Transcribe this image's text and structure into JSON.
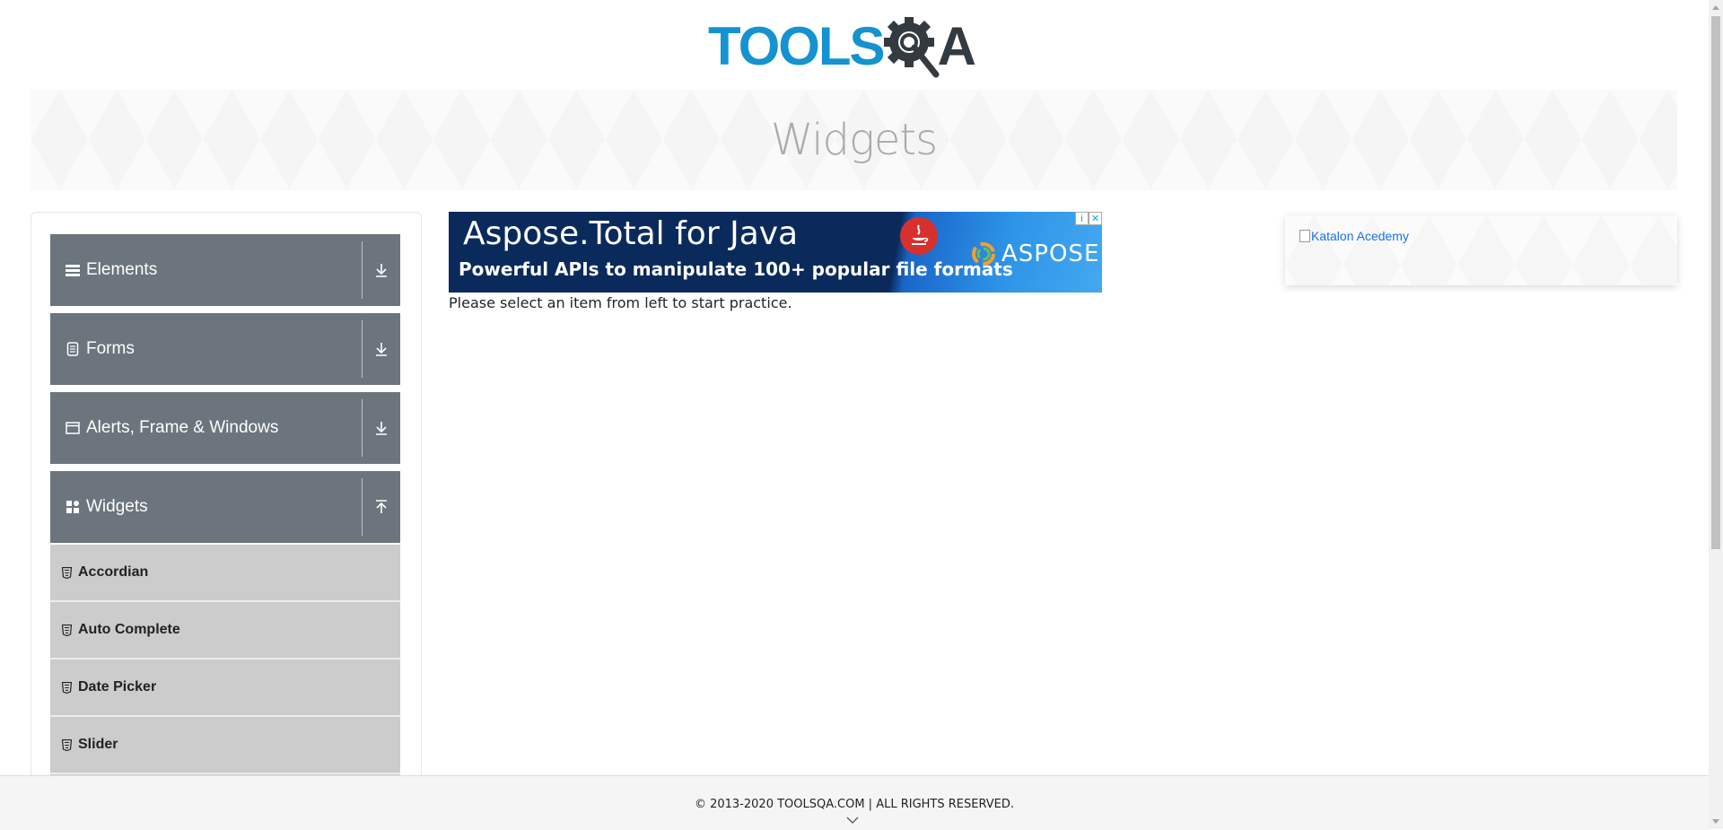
{
  "logo": {
    "part1": "TOOLS",
    "part2": "A",
    "icon": "gear-magnifier-icon",
    "colors": {
      "tools": "#1592d0",
      "dark": "#333a40"
    }
  },
  "banner": {
    "title": "Widgets"
  },
  "sidebar": {
    "groups": [
      {
        "label": "Elements",
        "icon": "hamburger-icon",
        "state": "collapsed"
      },
      {
        "label": "Forms",
        "icon": "document-icon",
        "state": "collapsed"
      },
      {
        "label": "Alerts, Frame & Windows",
        "icon": "window-icon",
        "state": "collapsed"
      },
      {
        "label": "Widgets",
        "icon": "grid-icon",
        "state": "expanded"
      }
    ],
    "widget_items": [
      {
        "label": "Accordian"
      },
      {
        "label": "Auto Complete"
      },
      {
        "label": "Date Picker"
      },
      {
        "label": "Slider"
      }
    ],
    "colors": {
      "group_bg": "#6c757d",
      "item_bg": "#cccccc"
    }
  },
  "ad": {
    "title": "Aspose.Total for Java",
    "subtitle": "Powerful APIs to manipulate 100+ popular file formats",
    "brand": "ASPOSE",
    "choices_info": "i",
    "choices_close": "✕"
  },
  "main": {
    "intro": "Please select an item from left to start practice."
  },
  "right_ad": {
    "alt_text": "Katalon Acedemy"
  },
  "footer": {
    "copyright": "© 2013-2020 TOOLSQA.COM | ALL RIGHTS RESERVED."
  }
}
